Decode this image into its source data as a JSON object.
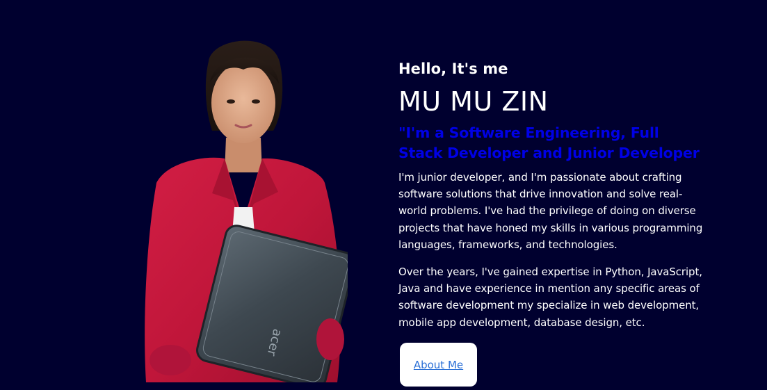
{
  "hero": {
    "greeting": "Hello, It's me",
    "name": "MU MU ZIN",
    "tagline": "\"I'm a Software Engineering, Full Stack Developer and Junior Developer",
    "paragraphs": [
      "I'm junior developer, and I'm passionate about crafting software solutions that drive innovation and solve real-world problems. I've had the privilege of doing on diverse projects that have honed my skills in various programming languages, frameworks, and technologies.",
      "Over the years, I've gained expertise in Python, JavaScript, Java and have experience in mention any specific areas of software development my specialize in web development, mobile app development, database design, etc."
    ],
    "about_button": "About Me",
    "laptop_brand": "acer"
  },
  "colors": {
    "background": "#00002f",
    "tagline": "#0000e6",
    "text": "#ffffff",
    "button_bg": "#ffffff",
    "button_link": "#2a6fd6",
    "blazer": "#c8183c"
  },
  "icons": {
    "portrait": "person-with-laptop-photo"
  }
}
